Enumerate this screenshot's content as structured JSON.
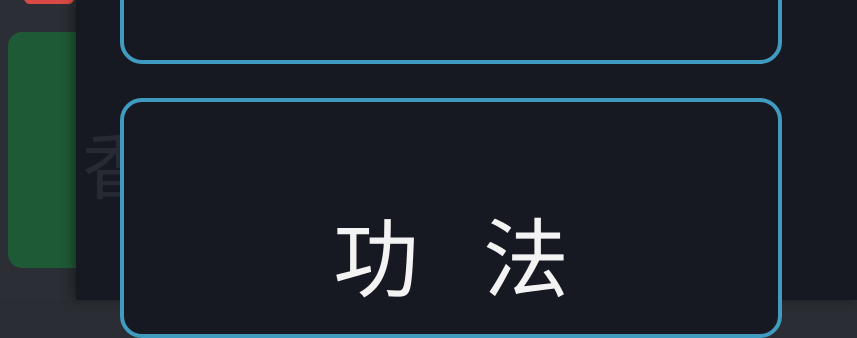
{
  "background_watermark": "香辣升仙丹",
  "menu": {
    "top_card_label": "",
    "technique_label": "功法"
  },
  "colors": {
    "panel_bg": "#161922",
    "card_border": "#3f9cc0",
    "green_button": "#1f5a36",
    "red_accent": "#d94a45"
  }
}
